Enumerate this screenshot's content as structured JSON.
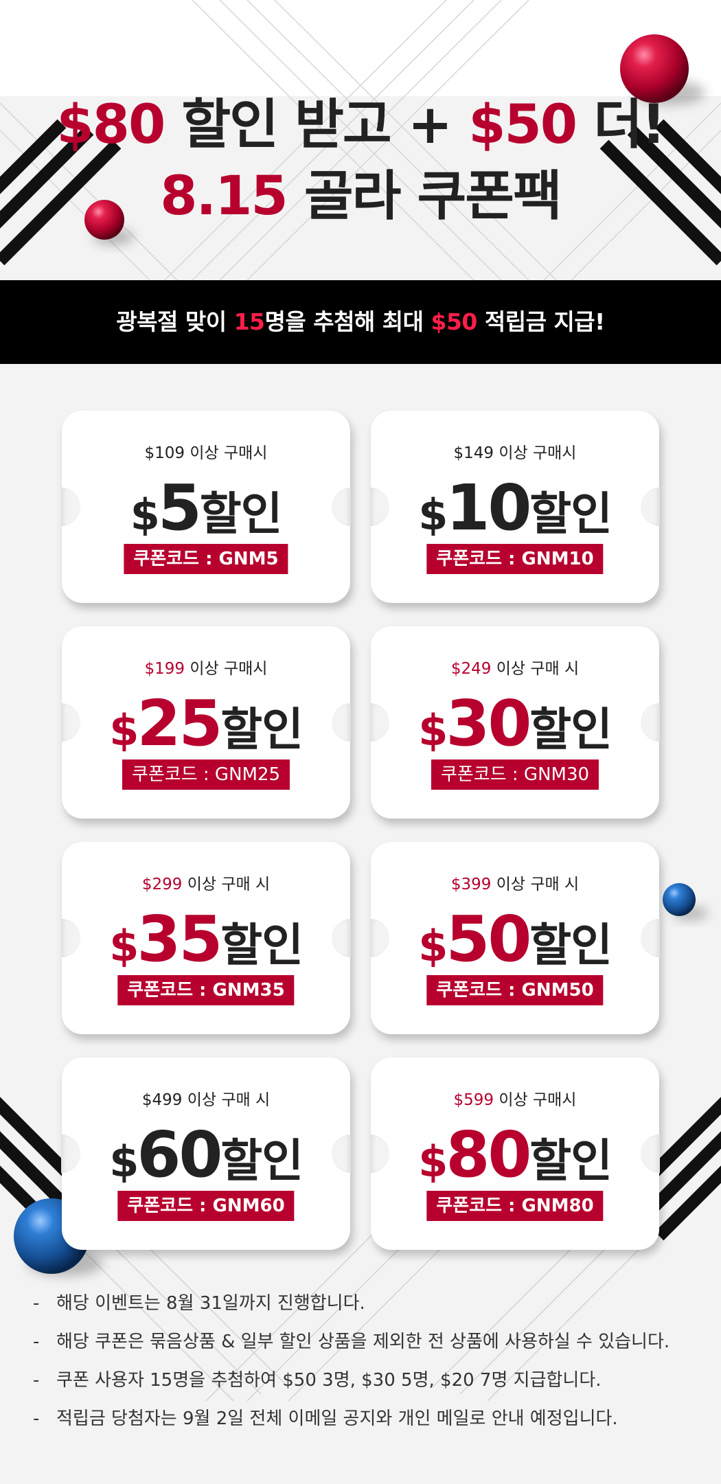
{
  "headline": {
    "line1_red1": "$80",
    "line1_mid": "할인 받고 +",
    "line1_red2": "$50",
    "line1_end": "더!",
    "line2_red": "8.15",
    "line2_dark": "골라 쿠폰팩"
  },
  "banner": {
    "pre": "광복절 맞이 ",
    "count": "15",
    "mid": "명을 추첨해 최대 ",
    "amount": "$50",
    "post": " 적립금 지급!"
  },
  "coupons": [
    {
      "min_amount": "$109",
      "min_suffix": "이상 구매시",
      "currency": "$",
      "discount": "5",
      "unit": "할인",
      "code_text": "쿠폰코드 : GNM5"
    },
    {
      "min_amount": "$149",
      "min_suffix": "이상 구매시",
      "currency": "$",
      "discount": "10",
      "unit": "할인",
      "code_text": "쿠폰코드 : GNM10"
    },
    {
      "min_amount": "$199",
      "min_suffix": "이상 구매시",
      "currency": "$",
      "discount": "25",
      "unit": "할인",
      "code_text": "쿠폰코드 : GNM25"
    },
    {
      "min_amount": "$249",
      "min_suffix": "이상 구매 시",
      "currency": "$",
      "discount": "30",
      "unit": "할인",
      "code_text": "쿠폰코드 : GNM30"
    },
    {
      "min_amount": "$299",
      "min_suffix": "이상 구매 시",
      "currency": "$",
      "discount": "35",
      "unit": "할인",
      "code_text": "쿠폰코드 : GNM35"
    },
    {
      "min_amount": "$399",
      "min_suffix": "이상 구매 시",
      "currency": "$",
      "discount": "50",
      "unit": "할인",
      "code_text": "쿠폰코드 : GNM50"
    },
    {
      "min_amount": "$499",
      "min_suffix": "이상 구매 시",
      "currency": "$",
      "discount": "60",
      "unit": "할인",
      "code_text": "쿠폰코드 : GNM60"
    },
    {
      "min_amount": "$599",
      "min_suffix": "이상 구매시",
      "currency": "$",
      "discount": "80",
      "unit": "할인",
      "code_text": "쿠폰코드 : GNM80"
    }
  ],
  "notes": {
    "bullet": "-",
    "items": [
      "해당 이벤트는 8월 31일까지 진행합니다.",
      "해당 쿠폰은 묶음상품 & 일부 할인 상품을 제외한 전 상품에 사용하실 수 있습니다.",
      "쿠폰 사용자 15명을 추첨하여 $50 3명, $30 5명, $20 7명 지급합니다.",
      "적립금 당첨자는 9월 2일 전체 이메일 공지와 개인 메일로 안내 예정입니다."
    ]
  },
  "colors": {
    "accent_red": "#b7002d",
    "banner_highlight": "#ff1e4a",
    "banner_bg": "#000000",
    "page_bg": "#f3f3f3",
    "ball_red": "#c0103a",
    "ball_blue": "#1f5fa8"
  }
}
